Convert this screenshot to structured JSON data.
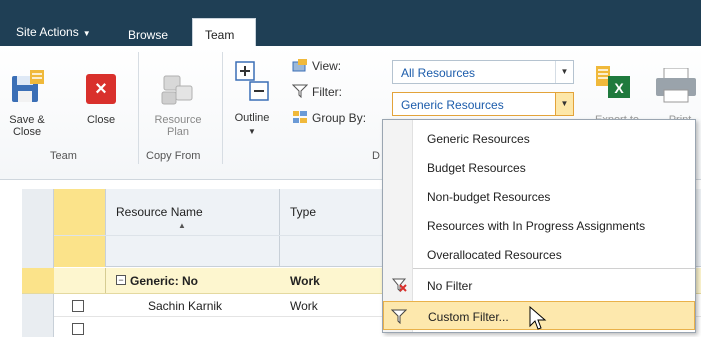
{
  "topbar": {
    "site_actions": "Site Actions",
    "browse": "Browse",
    "team_tab": "Team"
  },
  "ribbon": {
    "save_close": [
      "Save &",
      "Close"
    ],
    "close": "Close",
    "resource_plan": [
      "Resource",
      "Plan"
    ],
    "outline": "Outline",
    "view_label": "View:",
    "filter_label": "Filter:",
    "group_by_label": "Group By:",
    "view_value": "All Resources",
    "filter_value": "Generic Resources",
    "export": "Export to",
    "print": "Print",
    "groups": {
      "team": "Team",
      "copy_from": "Copy From",
      "data": "D"
    }
  },
  "filter_menu": {
    "items": [
      "Generic Resources",
      "Budget Resources",
      "Non-budget Resources",
      "Resources with In Progress Assignments",
      "Overallocated Resources",
      "No Filter",
      "Custom Filter..."
    ],
    "highlighted_index": 6
  },
  "grid": {
    "columns": [
      "Resource Name",
      "Type"
    ],
    "group_row": {
      "label": "Generic: No",
      "type": "Work"
    },
    "rows": [
      {
        "name": "Sachin Karnik",
        "type": "Work"
      },
      {
        "name": "",
        "type": ""
      }
    ]
  },
  "colors": {
    "topbar": "#1f3f55",
    "accent_link": "#1c5cab",
    "highlight": "#fde8ad",
    "group_row": "#fdf6cf",
    "selected_column": "#fbe38a"
  }
}
